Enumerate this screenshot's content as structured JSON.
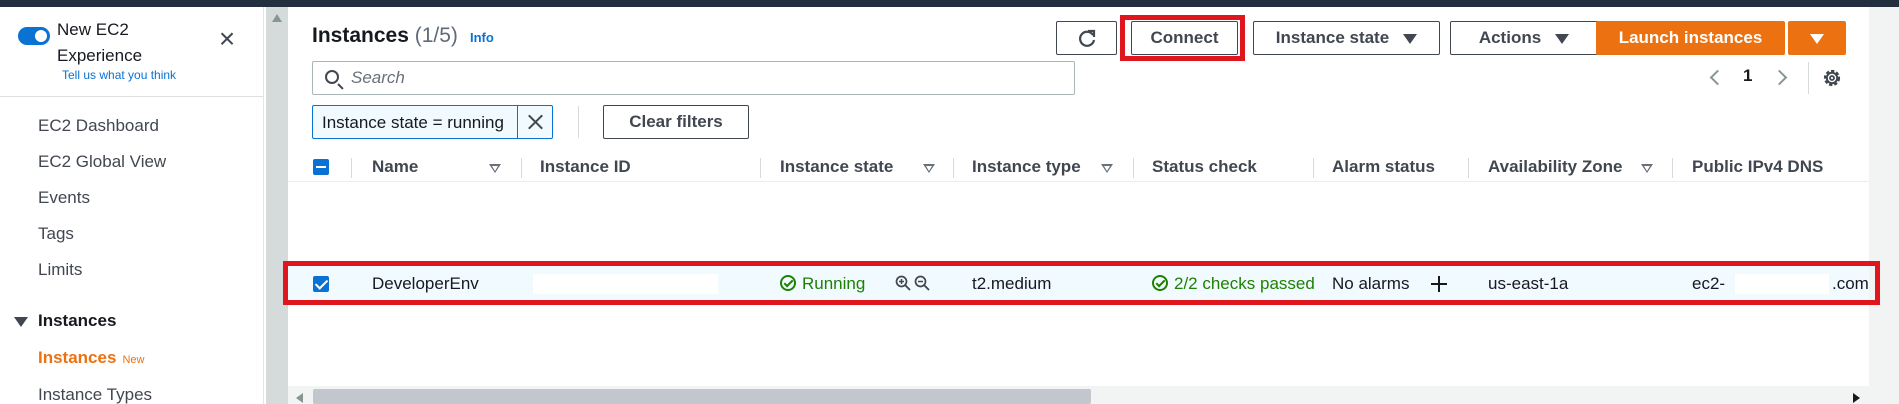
{
  "colors": {
    "accent": "#0972d3",
    "brand_orange": "#ec7211",
    "success": "#1d8102",
    "highlight_red": "#e0161e"
  },
  "sidebar": {
    "experience_title": "New EC2 Experience",
    "feedback_link": "Tell us what you think",
    "close_icon": "close-icon",
    "items": [
      {
        "label": "EC2 Dashboard"
      },
      {
        "label": "EC2 Global View"
      },
      {
        "label": "Events"
      },
      {
        "label": "Tags"
      },
      {
        "label": "Limits"
      }
    ],
    "section": {
      "label": "Instances",
      "expanded": true
    },
    "section_items": [
      {
        "label": "Instances",
        "badge": "New",
        "active": true
      },
      {
        "label": "Instance Types"
      }
    ]
  },
  "header": {
    "title": "Instances",
    "count": "(1/5)",
    "info_link": "Info"
  },
  "toolbar": {
    "refresh_icon": "refresh-icon",
    "connect_label": "Connect",
    "instance_state_label": "Instance state",
    "actions_label": "Actions",
    "launch_label": "Launch instances"
  },
  "search": {
    "placeholder": "Search",
    "value": ""
  },
  "pagination": {
    "current_page": "1"
  },
  "filters": {
    "active_token": "Instance state = running",
    "clear_label": "Clear filters"
  },
  "table": {
    "columns": [
      "Name",
      "Instance ID",
      "Instance state",
      "Instance type",
      "Status check",
      "Alarm status",
      "Availability Zone",
      "Public IPv4 DNS"
    ],
    "rows": [
      {
        "selected": true,
        "name": "DeveloperEnv",
        "instance_id": "",
        "state": "Running",
        "type": "t2.medium",
        "status_check": "2/2 checks passed",
        "alarm_status": "No alarms",
        "zone": "us-east-1a",
        "dns_prefix": "ec2-",
        "dns_suffix": ".com"
      }
    ]
  }
}
